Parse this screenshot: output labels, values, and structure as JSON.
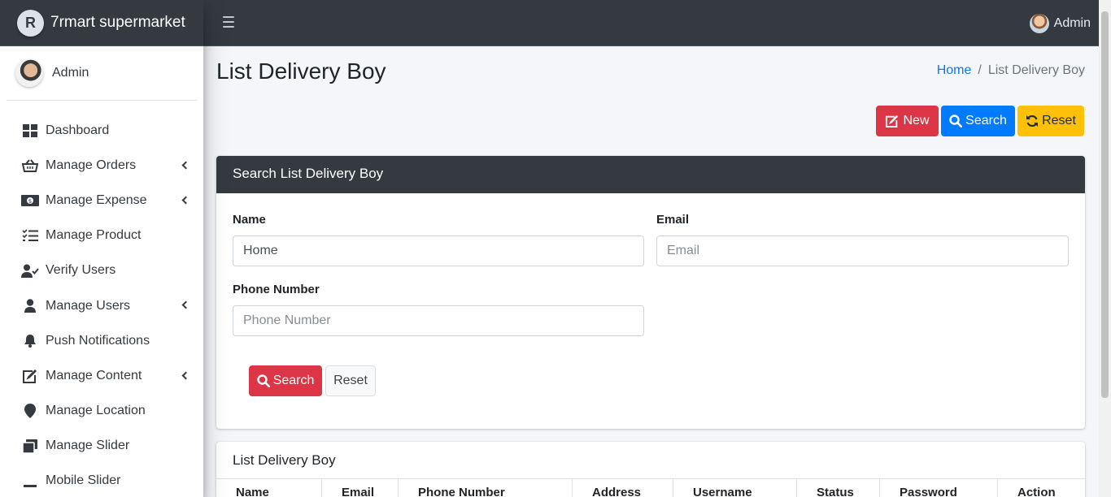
{
  "app": {
    "brand": "7rmart supermarket",
    "logo_letter": "R"
  },
  "topbar": {
    "user": "Admin"
  },
  "sidebar": {
    "user": "Admin",
    "items": [
      {
        "label": "Dashboard",
        "icon": "dashboard-icon",
        "expandable": false
      },
      {
        "label": "Manage Orders",
        "icon": "basket-icon",
        "expandable": true
      },
      {
        "label": "Manage Expense",
        "icon": "money-icon",
        "expandable": true
      },
      {
        "label": "Manage Product",
        "icon": "tasks-icon",
        "expandable": false
      },
      {
        "label": "Verify Users",
        "icon": "user-check-icon",
        "expandable": false
      },
      {
        "label": "Manage Users",
        "icon": "user-icon",
        "expandable": true
      },
      {
        "label": "Push Notifications",
        "icon": "bell-icon",
        "expandable": false
      },
      {
        "label": "Manage Content",
        "icon": "edit-icon",
        "expandable": true
      },
      {
        "label": "Manage Location",
        "icon": "map-marker-icon",
        "expandable": false
      },
      {
        "label": "Manage Slider",
        "icon": "slider-icon",
        "expandable": false
      },
      {
        "label": "Mobile Slider",
        "icon": "minus-icon",
        "expandable": false
      }
    ]
  },
  "page": {
    "title": "List Delivery Boy",
    "breadcrumb": {
      "home": "Home",
      "separator": "/",
      "current": "List Delivery Boy"
    }
  },
  "actions": {
    "new": "New",
    "search": "Search",
    "reset": "Reset"
  },
  "search_card": {
    "title": "Search List Delivery Boy",
    "name_label": "Name",
    "name_value": "Home",
    "name_placeholder": "",
    "email_label": "Email",
    "email_placeholder": "Email",
    "phone_label": "Phone Number",
    "phone_placeholder": "Phone Number",
    "search_button": "Search",
    "reset_button": "Reset"
  },
  "list_card": {
    "title": "List Delivery Boy",
    "columns": [
      "Name",
      "Email",
      "Phone Number",
      "Address",
      "Username",
      "Status",
      "Password",
      "Action"
    ]
  },
  "colors": {
    "danger": "#dc3545",
    "primary": "#007bff",
    "warning": "#ffc107",
    "dark": "#343a40"
  }
}
